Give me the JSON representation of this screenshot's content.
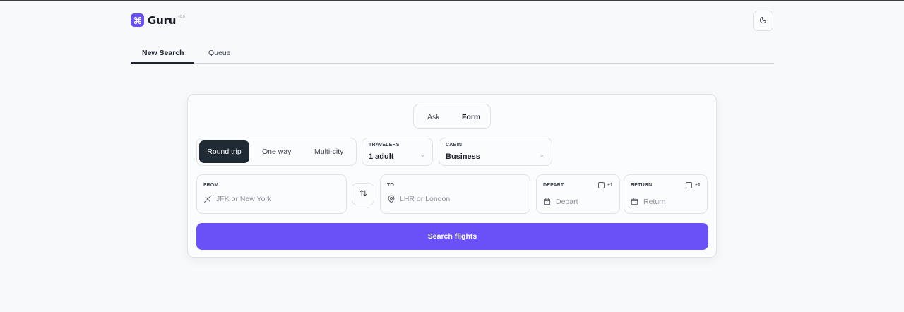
{
  "app": {
    "name": "Guru",
    "version": "v0.8",
    "logo_icon": "command-icon",
    "accent": "#6a51f7"
  },
  "header": {
    "theme_toggle_icon": "moon-icon"
  },
  "nav": {
    "tabs": [
      {
        "label": "New Search",
        "active": true
      },
      {
        "label": "Queue",
        "active": false
      }
    ]
  },
  "mode": {
    "options": [
      "Ask",
      "Form"
    ],
    "selected": "Form"
  },
  "trip_type": {
    "options": [
      "Round trip",
      "One way",
      "Multi-city"
    ],
    "selected": "Round trip"
  },
  "travelers": {
    "label": "TRAVELERS",
    "value": "1 adult"
  },
  "cabin": {
    "label": "CABIN",
    "value": "Business"
  },
  "from": {
    "label": "FROM",
    "placeholder": "JFK or New York",
    "icon": "plane-departure-icon"
  },
  "to": {
    "label": "TO",
    "placeholder": "LHR or London",
    "icon": "map-pin-icon"
  },
  "swap": {
    "icon": "swap-arrows-icon"
  },
  "depart": {
    "label": "DEPART",
    "flex_label": "±1",
    "placeholder": "Depart",
    "icon": "calendar-icon"
  },
  "return": {
    "label": "RETURN",
    "flex_label": "±1",
    "placeholder": "Return",
    "icon": "calendar-icon"
  },
  "actions": {
    "search_label": "Search flights"
  }
}
